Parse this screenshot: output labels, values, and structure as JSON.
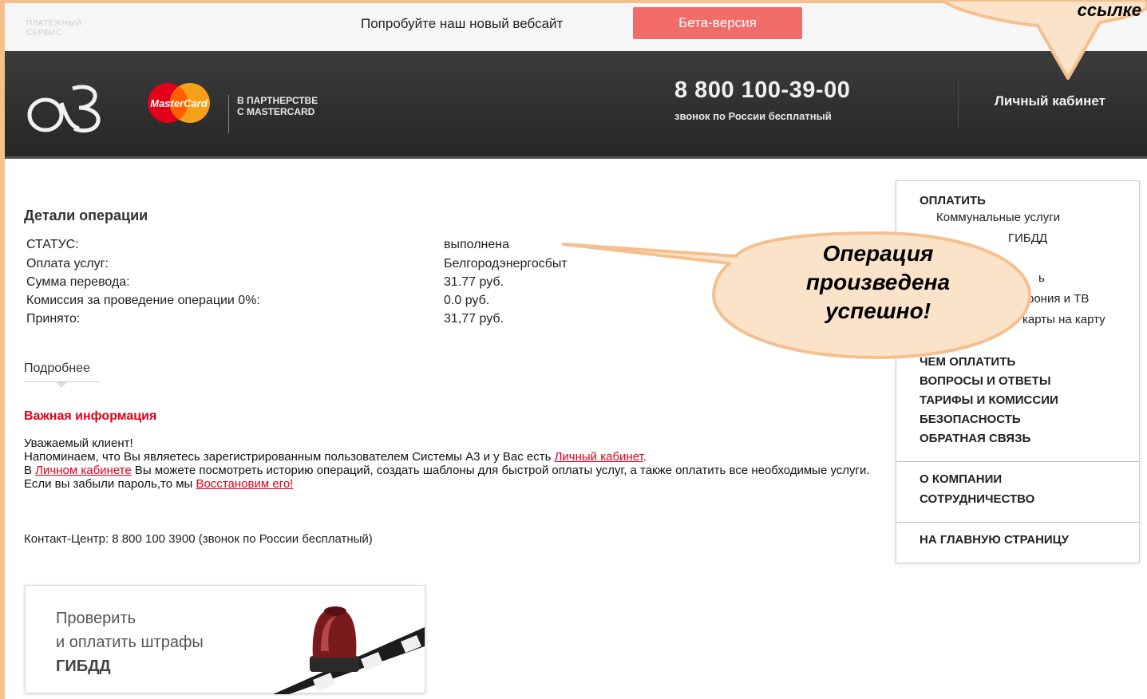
{
  "beta_bar": {
    "text": "Попробуйте наш новый вебсайт",
    "button_label": "Бета-версия"
  },
  "header": {
    "logo_caption_line1": "ПЛАТЕЖНЫЙ",
    "logo_caption_line2": "СЕРВИС",
    "logo_mark": "a3",
    "mastercard_text": "MasterCard",
    "partner_line1": "В ПАРТНЕРСТВЕ",
    "partner_line2": "С MASTERCARD",
    "phone": "8 800 100-39-00",
    "phone_note": "звонок по России бесплатный",
    "cabinet_link": "Личный кабинет"
  },
  "details": {
    "title": "Детали операции",
    "rows": [
      {
        "label": "СТАТУС:",
        "value": "выполнена"
      },
      {
        "label": "Оплата услуг:",
        "value": "Белгородэнергосбыт"
      },
      {
        "label": "Сумма перевода:",
        "value": "31.77 руб."
      },
      {
        "label": "Комиссия за проведение операции 0%:",
        "value": "0.0 руб."
      },
      {
        "label": "Принято:",
        "value": "31,77 руб."
      }
    ],
    "more_link": "Подробнее"
  },
  "important": {
    "title": "Важная информация",
    "greeting": "Уважаемый клиент!",
    "line1_pre": "Напоминаем, что Вы являетесь зарегистрированным пользователем Системы А3 и у Вас есть ",
    "line1_link": "Личный кабинет",
    "line1_post": ".",
    "line2_pre": "В ",
    "line2_link": "Личном кабинете",
    "line2_post": " Вы можете посмотреть историю операций, создать шаблоны для быстрой оплаты услуг, а также оплатить все необходимые услуги.",
    "line3_pre": "Если вы забыли пароль,то мы ",
    "line3_link": "Восстановим его!",
    "contact": "Контакт-Центр: 8 800 100 3900 (звонок по России бесплатный)"
  },
  "promo": {
    "line1": "Проверить",
    "line2": "и оплатить штрафы",
    "line3": "ГИБДД"
  },
  "sidebar": {
    "pay_title": "ОПЛАТИТЬ",
    "pay_items": [
      "Коммунальные услуги",
      "ГИБДД",
      "ь",
      "фония и ТВ",
      "карты на карту"
    ],
    "sections": [
      "ЧЕМ ОПЛАТИТЬ",
      "ВОПРОСЫ И ОТВЕТЫ",
      "ТАРИФЫ И КОМИССИИ",
      "БЕЗОПАСНОСТЬ",
      "ОБРАТНАЯ СВЯЗЬ"
    ],
    "company": [
      "О КОМПАНИИ",
      "СОТРУДНИЧЕСТВО"
    ],
    "home": "НА ГЛАВНУЮ СТРАНИЦУ"
  },
  "callouts": {
    "top_right": "ссылке",
    "middle_line1": "Операция",
    "middle_line2": "произведена",
    "middle_line3": "успешно!"
  },
  "colors": {
    "accent_red": "#e2001a",
    "beta_button": "#f26d6a",
    "callout_fill": "#fbe3c9",
    "callout_border": "#f5c08f",
    "header_bg": "#2e2e2e"
  }
}
